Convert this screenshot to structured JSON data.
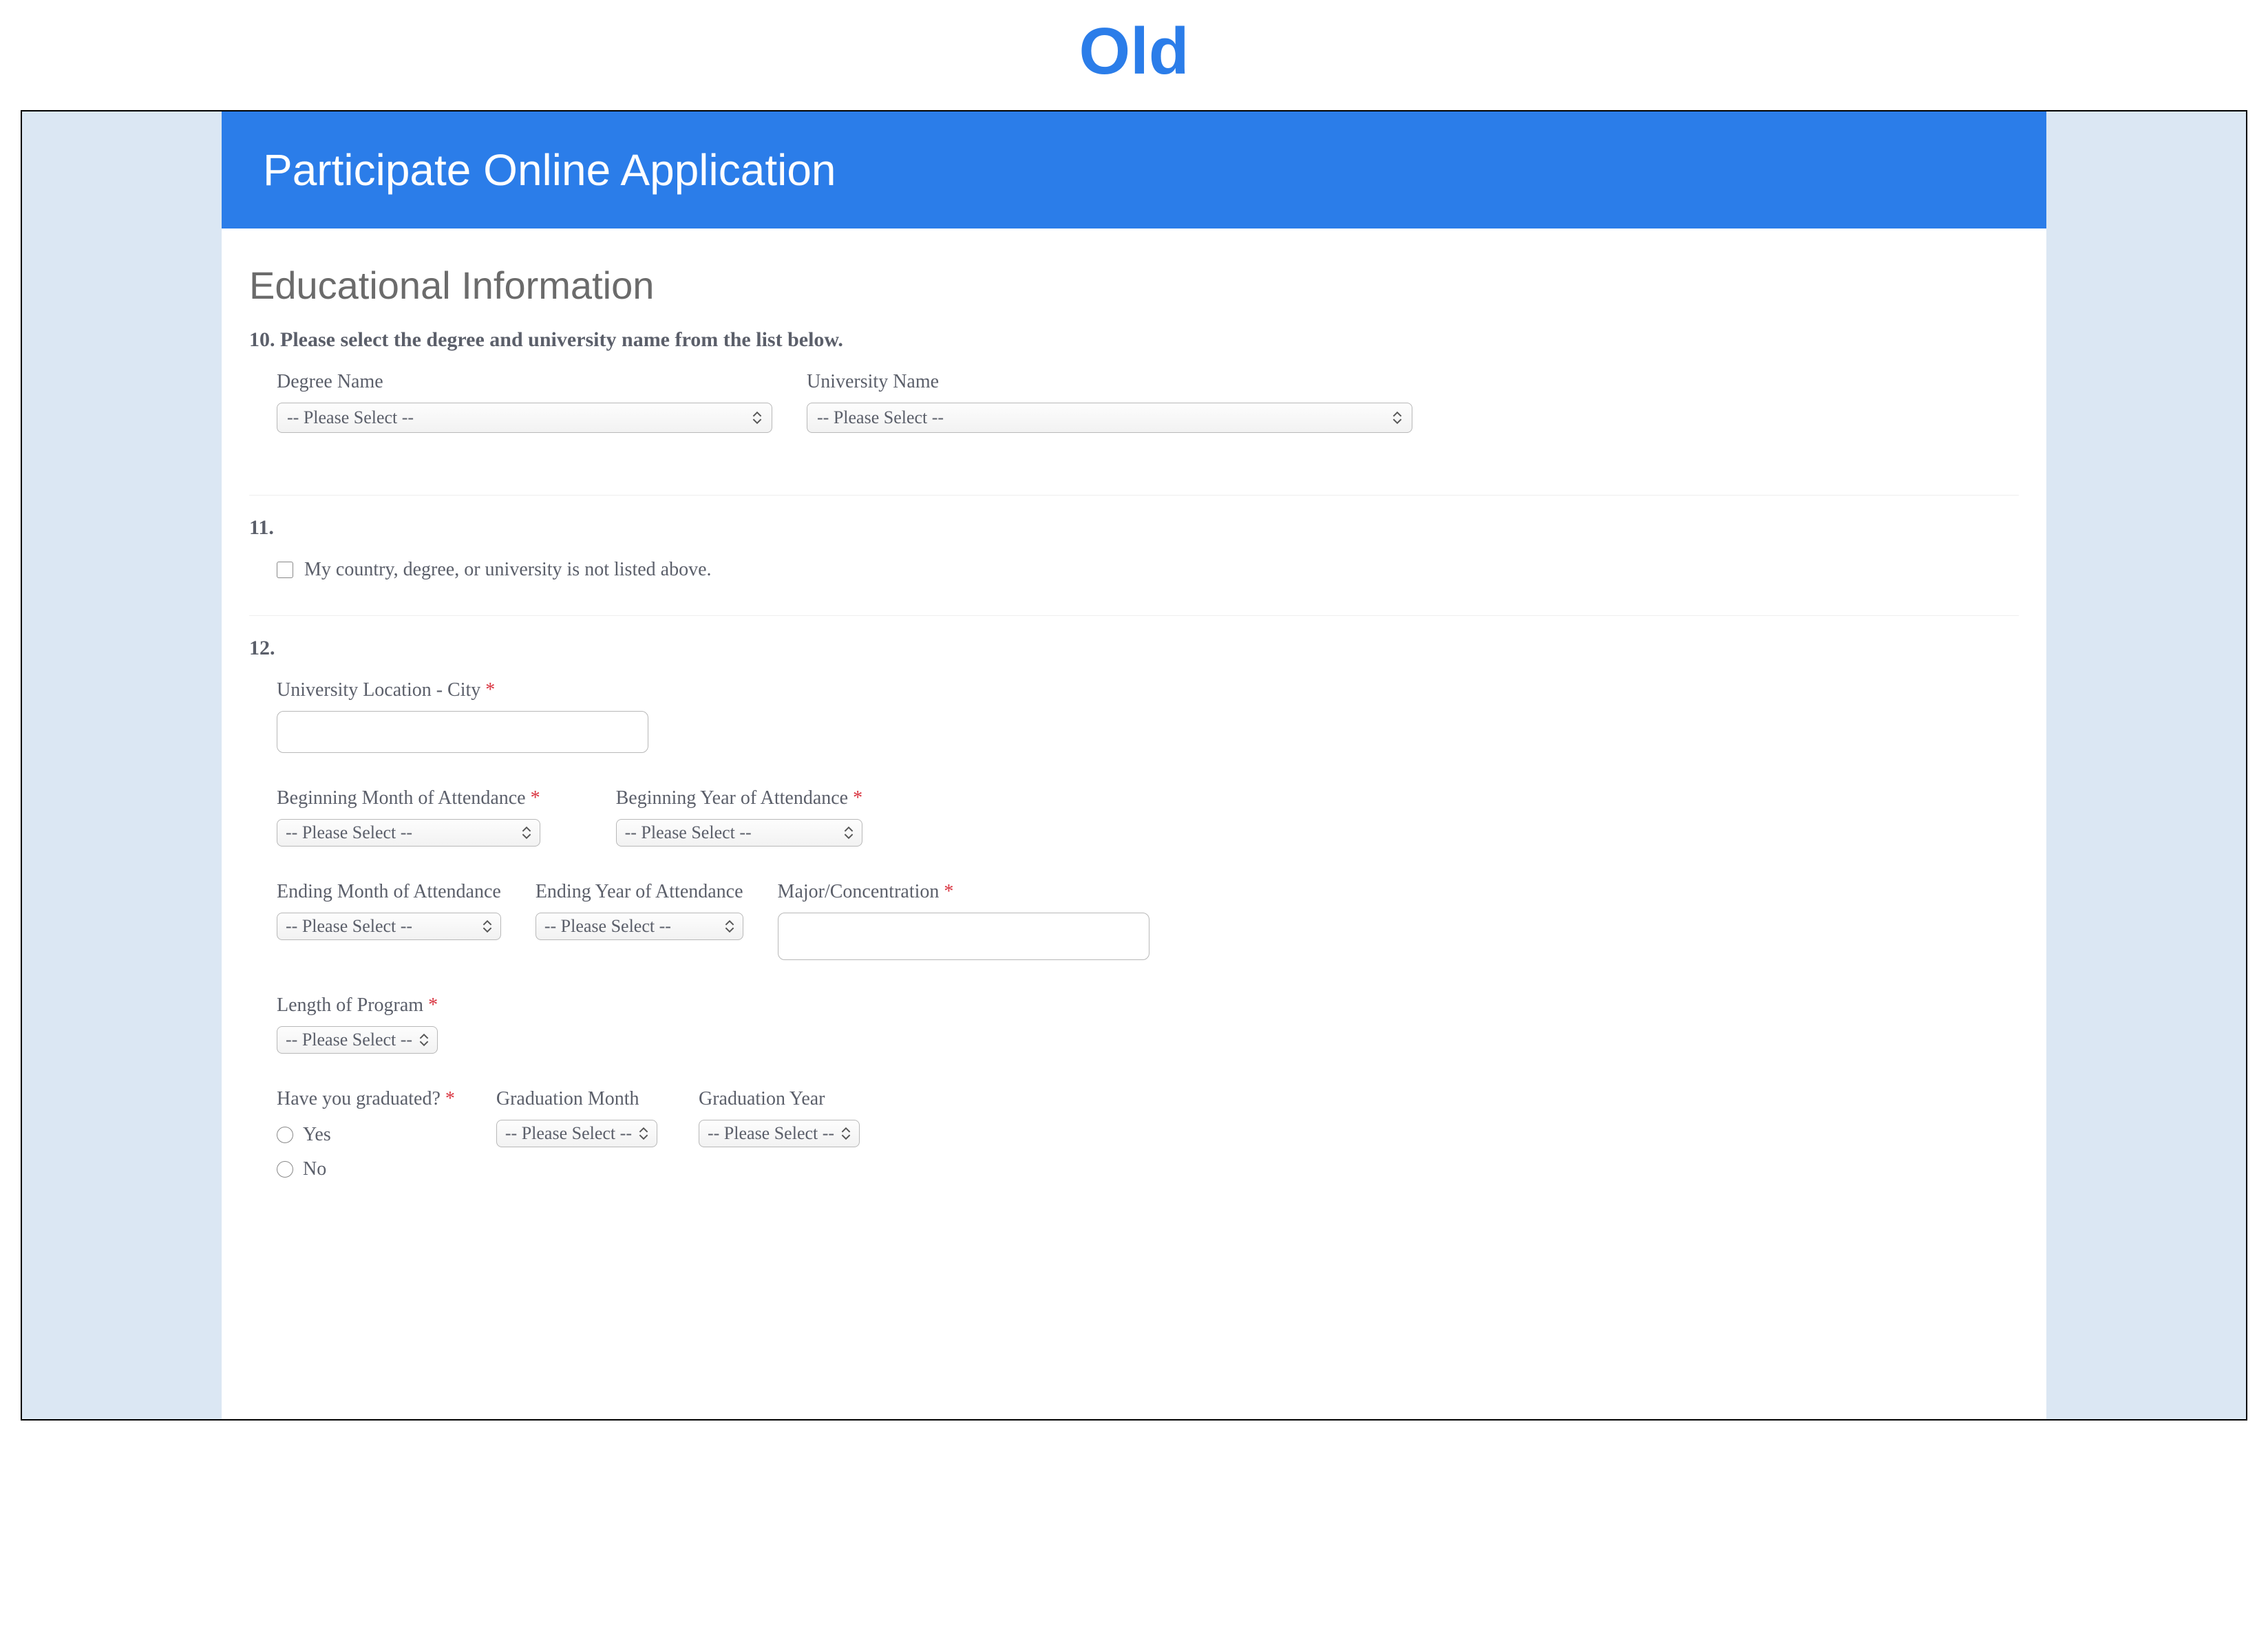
{
  "pageLabel": "Old",
  "header": {
    "title": "Participate Online Application"
  },
  "section": {
    "title": "Educational Information"
  },
  "q10": {
    "label": "10. Please select the degree and university name from the list below.",
    "degree": {
      "label": "Degree Name",
      "value": "-- Please Select --"
    },
    "university": {
      "label": "University Name",
      "value": "-- Please Select --"
    }
  },
  "q11": {
    "num": "11.",
    "checkbox": {
      "label": "My country, degree, or university is not listed above."
    }
  },
  "q12": {
    "num": "12.",
    "city": {
      "label": "University Location - City",
      "value": ""
    },
    "beginMonth": {
      "label": "Beginning Month of Attendance",
      "value": "-- Please Select --"
    },
    "beginYear": {
      "label": "Beginning Year of Attendance",
      "value": "-- Please Select --"
    },
    "endMonth": {
      "label": "Ending Month of Attendance",
      "value": "-- Please Select --"
    },
    "endYear": {
      "label": "Ending Year of Attendance",
      "value": "-- Please Select --"
    },
    "major": {
      "label": "Major/Concentration",
      "value": ""
    },
    "length": {
      "label": "Length of Program",
      "value": "-- Please Select --"
    },
    "graduated": {
      "label": "Have you graduated?",
      "yes": "Yes",
      "no": "No"
    },
    "gradMonth": {
      "label": "Graduation Month",
      "value": "-- Please Select --"
    },
    "gradYear": {
      "label": "Graduation Year",
      "value": "-- Please Select --"
    }
  },
  "required": "*"
}
